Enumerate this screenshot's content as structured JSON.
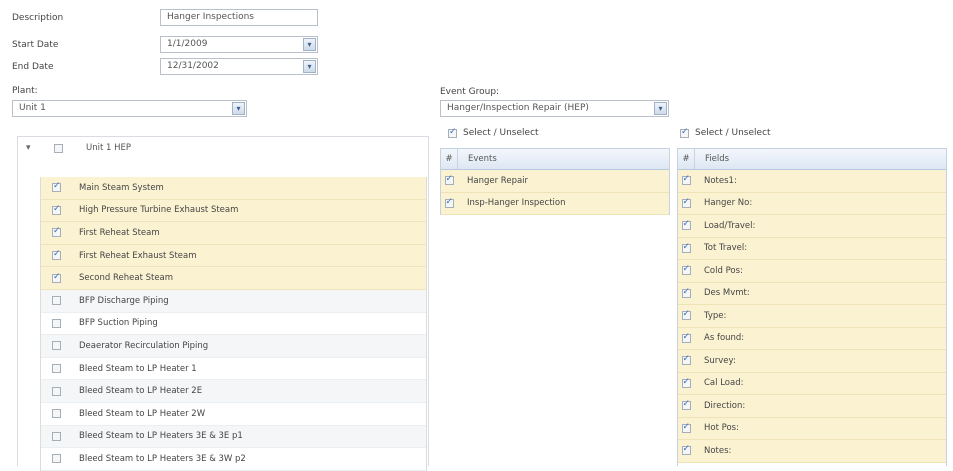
{
  "form": {
    "description_label": "Description",
    "description_value": "Hanger Inspections",
    "start_date_label": "Start Date",
    "start_date_value": "1/1/2009",
    "end_date_label": "End Date",
    "end_date_value": "12/31/2002",
    "plant_label": "Plant:",
    "plant_value": "Unit 1",
    "event_group_label": "Event Group:",
    "event_group_value": "Hanger/Inspection Repair (HEP)"
  },
  "tree": {
    "expand_glyph": "▾",
    "root_label": "Unit 1 HEP",
    "items": [
      {
        "label": "Main Steam System",
        "checked": true
      },
      {
        "label": "High Pressure Turbine Exhaust Steam",
        "checked": true
      },
      {
        "label": "First Reheat Steam",
        "checked": true
      },
      {
        "label": "First Reheat Exhaust Steam",
        "checked": true
      },
      {
        "label": "Second Reheat Steam",
        "checked": true
      },
      {
        "label": "BFP Discharge Piping",
        "checked": false
      },
      {
        "label": "BFP Suction Piping",
        "checked": false
      },
      {
        "label": "Deaerator Recirculation Piping",
        "checked": false
      },
      {
        "label": "Bleed Steam to LP Heater 1",
        "checked": false
      },
      {
        "label": "Bleed Steam to LP Heater 2E",
        "checked": false
      },
      {
        "label": "Bleed Steam to LP Heater 2W",
        "checked": false
      },
      {
        "label": "Bleed Steam to LP Heaters 3E & 3E p1",
        "checked": false
      },
      {
        "label": "Bleed Steam to LP Heaters 3E & 3W p2",
        "checked": false
      }
    ]
  },
  "events": {
    "select_label": "Select / Unselect",
    "hash": "#",
    "header": "Events",
    "items": [
      {
        "label": "Hanger Repair",
        "checked": true
      },
      {
        "label": "Insp-Hanger Inspection",
        "checked": true
      }
    ]
  },
  "fields": {
    "select_label": "Select / Unselect",
    "hash": "#",
    "header": "Fields",
    "items": [
      {
        "label": "Notes1:",
        "checked": true
      },
      {
        "label": "Hanger No:",
        "checked": true
      },
      {
        "label": "Load/Travel:",
        "checked": true
      },
      {
        "label": "Tot Travel:",
        "checked": true
      },
      {
        "label": "Cold Pos:",
        "checked": true
      },
      {
        "label": "Des Mvmt:",
        "checked": true
      },
      {
        "label": "Type:",
        "checked": true
      },
      {
        "label": "As found:",
        "checked": true
      },
      {
        "label": "Survey:",
        "checked": true
      },
      {
        "label": "Cal Load:",
        "checked": true
      },
      {
        "label": "Direction:",
        "checked": true
      },
      {
        "label": "Hot Pos:",
        "checked": true
      },
      {
        "label": "Notes:",
        "checked": true
      }
    ]
  },
  "icons": {
    "dropdown": "▾"
  }
}
